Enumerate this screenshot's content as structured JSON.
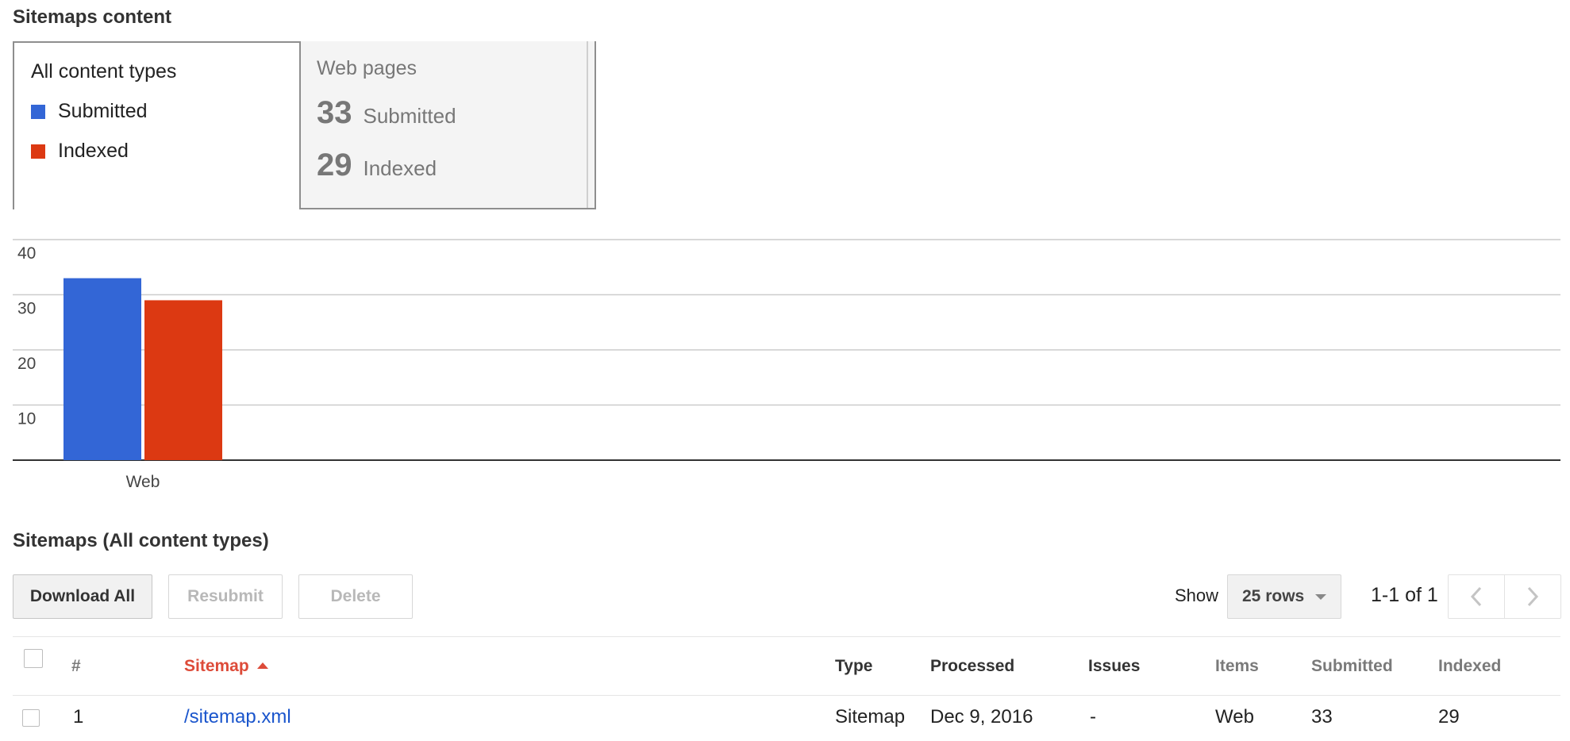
{
  "content_section": {
    "title": "Sitemaps content",
    "tabs": {
      "all": {
        "label": "All content types",
        "legend": [
          {
            "label": "Submitted",
            "color": "#3366d6"
          },
          {
            "label": "Indexed",
            "color": "#dc3912"
          }
        ]
      },
      "web": {
        "label": "Web pages",
        "submitted_count": "33",
        "submitted_label": "Submitted",
        "indexed_count": "29",
        "indexed_label": "Indexed"
      }
    }
  },
  "chart_data": {
    "type": "bar",
    "categories": [
      "Web"
    ],
    "series": [
      {
        "name": "Submitted",
        "values": [
          33
        ],
        "color": "#3366d6"
      },
      {
        "name": "Indexed",
        "values": [
          29
        ],
        "color": "#dc3912"
      }
    ],
    "ylim": [
      0,
      40
    ],
    "yticks": [
      10,
      20,
      30,
      40
    ],
    "grid": true
  },
  "table_section": {
    "title": "Sitemaps (All content types)",
    "toolbar": {
      "download_label": "Download All",
      "resubmit_label": "Resubmit",
      "delete_label": "Delete",
      "show_label": "Show",
      "rows_value": "25 rows",
      "page_info": "1-1 of 1"
    },
    "columns": {
      "num": "#",
      "sitemap": "Sitemap",
      "type": "Type",
      "processed": "Processed",
      "issues": "Issues",
      "items": "Items",
      "submitted": "Submitted",
      "indexed": "Indexed"
    },
    "rows": [
      {
        "num": "1",
        "sitemap": "/sitemap.xml",
        "type": "Sitemap",
        "processed": "Dec 9, 2016",
        "issues": "-",
        "items": "Web",
        "submitted": "33",
        "indexed": "29"
      }
    ]
  }
}
